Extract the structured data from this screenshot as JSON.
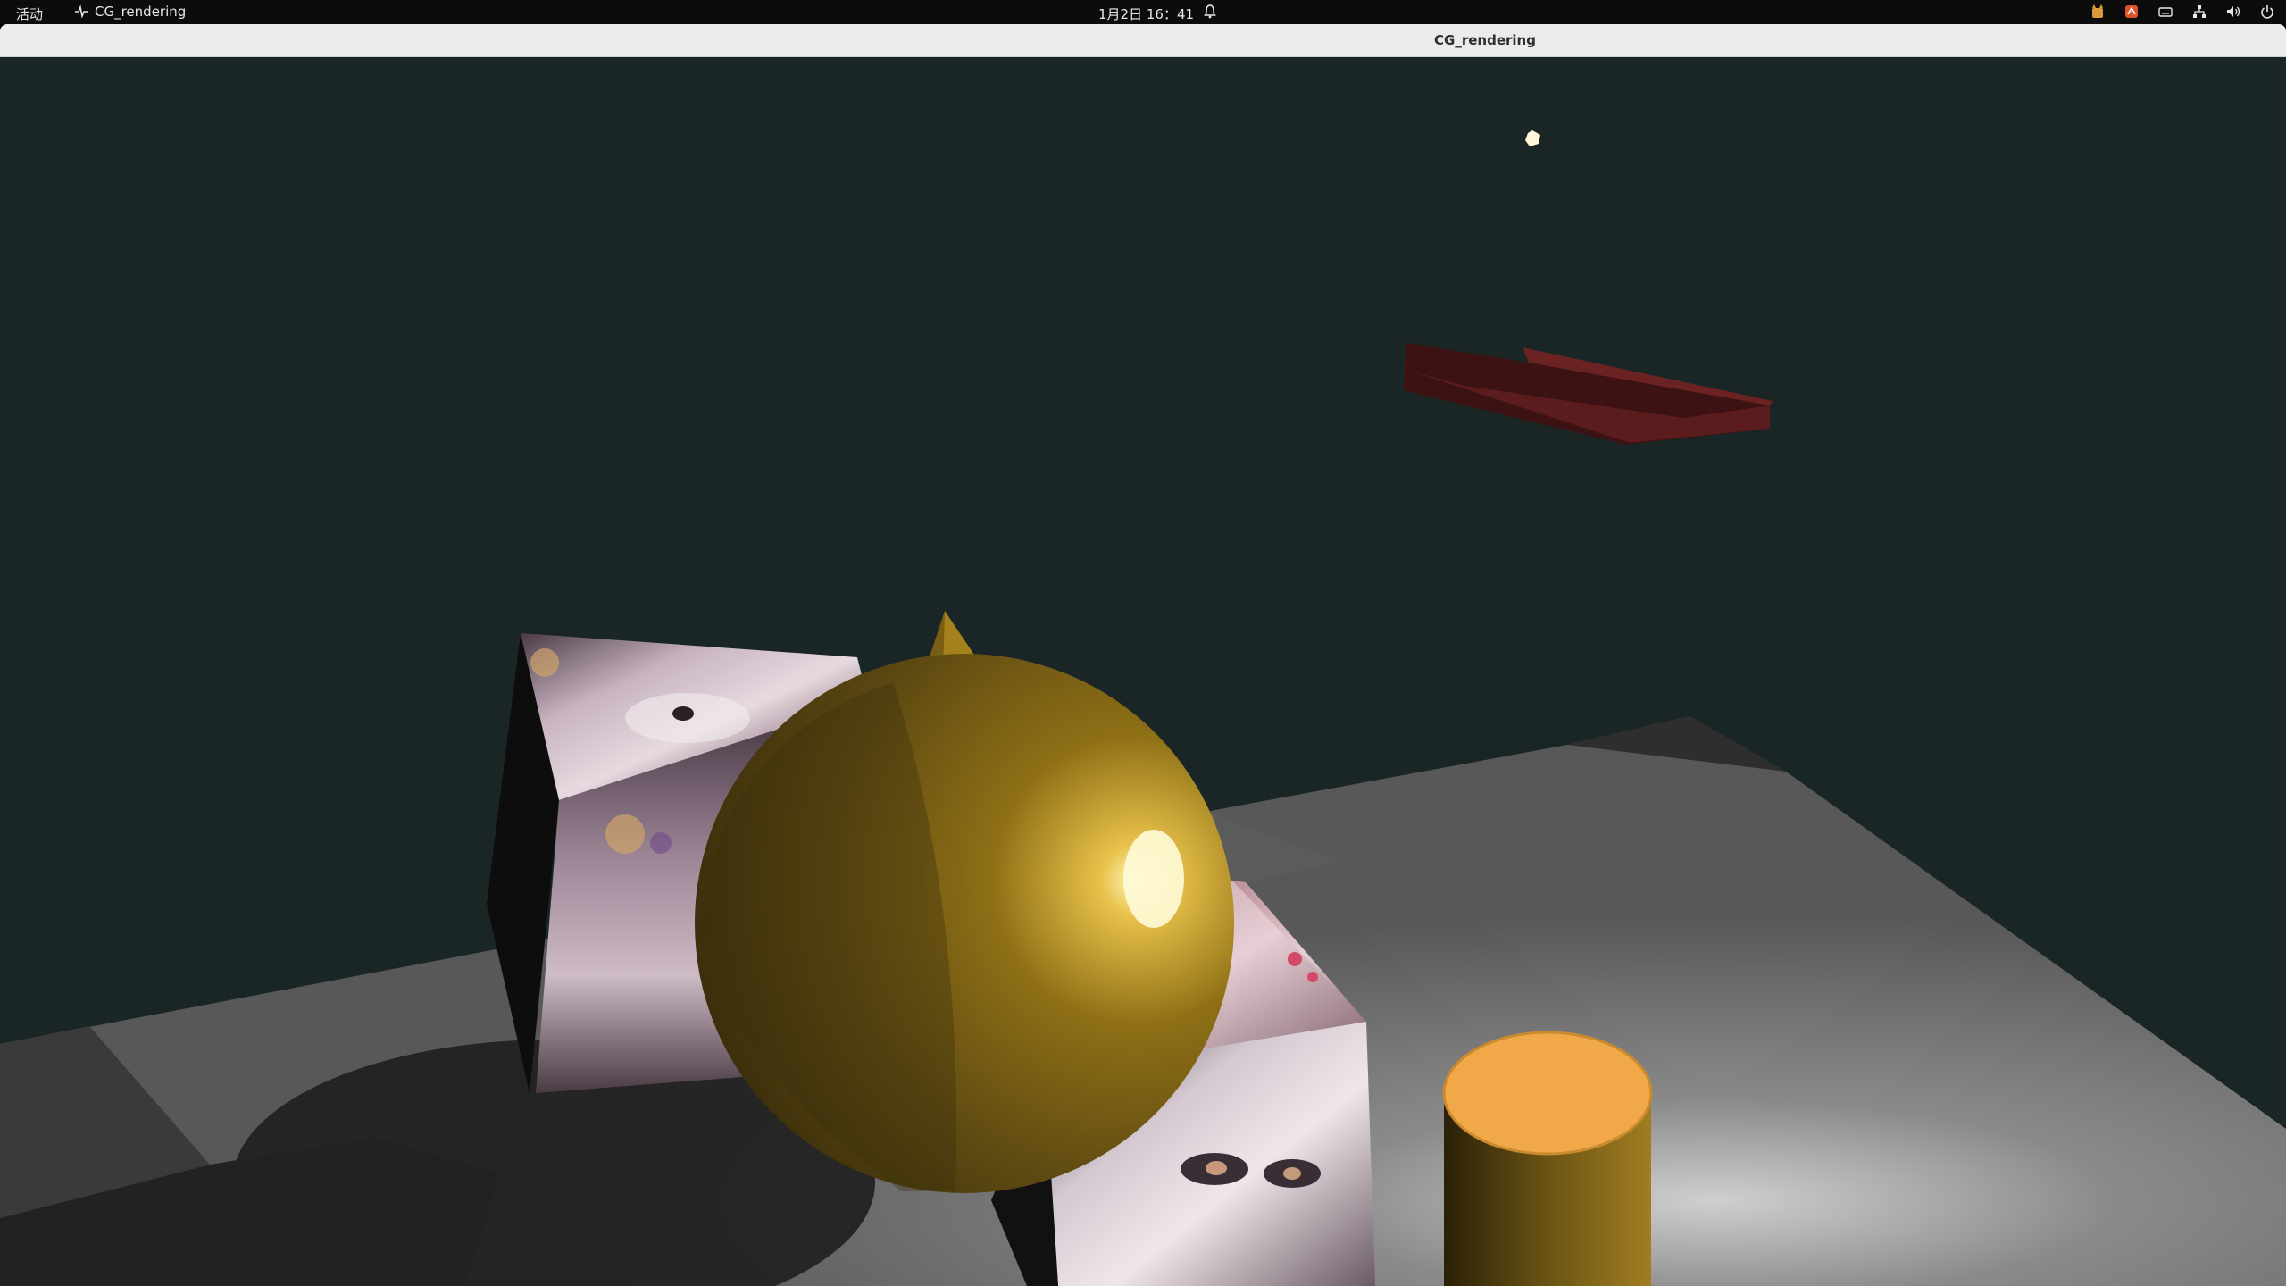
{
  "top_bar": {
    "activities_label": "活动",
    "app_name": "CG_rendering",
    "clock": "1月2日 16：41",
    "tray_icons": [
      "cat-app-icon",
      "app-indicator-icon",
      "keyboard-icon",
      "network-icon",
      "volume-icon",
      "power-icon"
    ]
  },
  "window": {
    "title": "CG_rendering"
  },
  "scene": {
    "background_color": "#1a2626",
    "objects": [
      "point-light",
      "red-tray",
      "textured-cube-left",
      "textured-cube-right",
      "gold-sphere",
      "gold-cone",
      "orange-cylinder",
      "gray-floor"
    ]
  },
  "colors": {
    "top_bar": "#0c0c0c",
    "title_bar": "#ebebeb",
    "gold": "#8f7016",
    "orange_cylinder_top": "#f0a848",
    "red_tray": "#5a1c1c"
  }
}
